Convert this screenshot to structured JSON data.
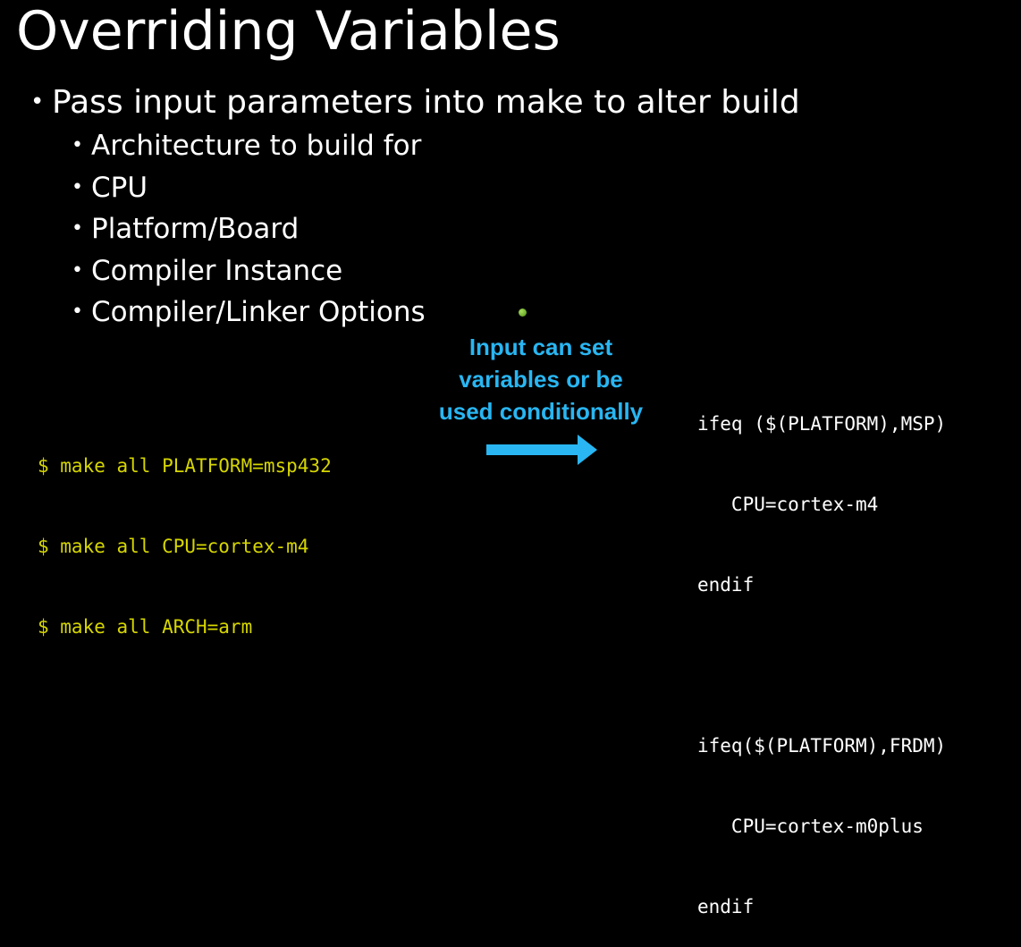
{
  "slide": {
    "title": "Overriding Variables",
    "main_bullet": "Pass input parameters into make to alter build",
    "sub_bullets": [
      "Architecture to build for",
      "CPU",
      "Platform/Board",
      "Compiler Instance",
      "Compiler/Linker Options"
    ],
    "bullet_glyph": "•"
  },
  "commands": [
    "$ make all PLATFORM=msp432",
    "$ make all CPU=cortex-m4",
    "$ make all ARCH=arm"
  ],
  "callout": {
    "lines": [
      "Input can set",
      "variables or be",
      "used conditionally"
    ],
    "color": "#29b6f2",
    "icon": "right-arrow-icon"
  },
  "code": [
    "ifeq ($(PLATFORM),MSP)",
    "   CPU=cortex-m4",
    "endif",
    "",
    "ifeq($(PLATFORM),FRDM)",
    "   CPU=cortex-m0plus",
    "endif"
  ],
  "colors": {
    "background": "#000000",
    "text": "#ffffff",
    "command_text": "#d6d600",
    "accent": "#29b6f2",
    "green_marker": "#6ab82a"
  }
}
